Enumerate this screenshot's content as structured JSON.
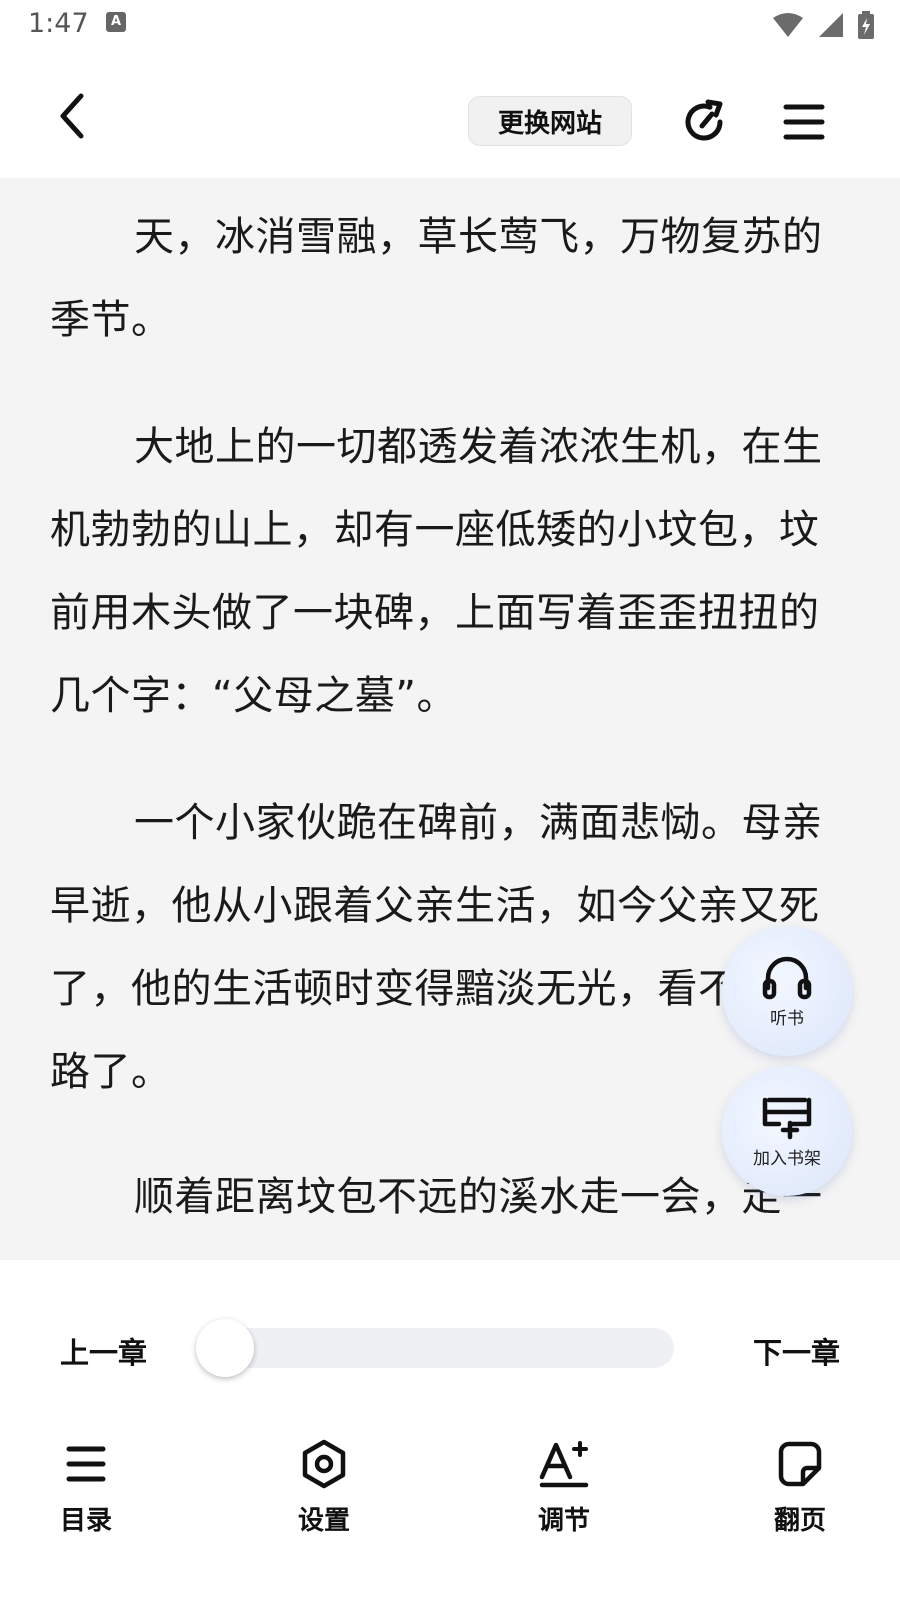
{
  "status_bar": {
    "time": "1:47",
    "notification_letter": "A"
  },
  "toolbar": {
    "switch_site": "更换网站"
  },
  "content": {
    "paragraphs": [
      "天，冰消雪融，草长莺飞，万物复苏的季节。",
      "大地上的一切都透发着浓浓生机，在生机勃勃的山上，却有一座低矮的小坟包，坟前用木头做了一块碑，上面写着歪歪扭扭的几个字：“父母之墓”。",
      "一个小家伙跪在碑前，满面悲恸。母亲早逝，他从小跟着父亲生活，如今父亲又死了，他的生活顿时变得黯淡无光，看不到出路了。",
      "顺着距离坟包不远的溪水走一会，走一"
    ]
  },
  "floating": {
    "listen": "听书",
    "add_shelf": "加入书架"
  },
  "chapter_nav": {
    "prev": "上一章",
    "next": "下一章",
    "progress": 0
  },
  "tabs": [
    {
      "label": "目录",
      "icon": "list-icon"
    },
    {
      "label": "设置",
      "icon": "settings-icon"
    },
    {
      "label": "调节",
      "icon": "font-adjust-icon"
    },
    {
      "label": "翻页",
      "icon": "page-turn-icon"
    }
  ]
}
